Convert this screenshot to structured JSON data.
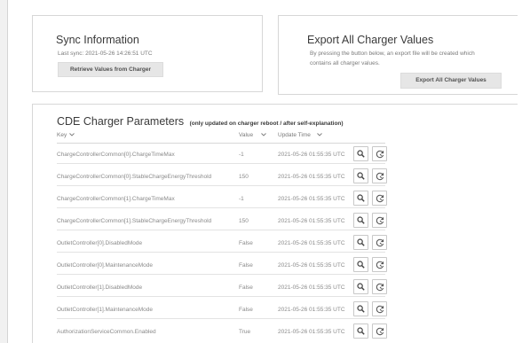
{
  "sync": {
    "title": "Sync Information",
    "last_sync": "Last sync: 2021-05-26 14:26:51 UTC",
    "button_label": "Retrieve Values from Charger"
  },
  "export": {
    "title": "Export All Charger Values",
    "description_line1": "By pressing the button below, an export file will be created which",
    "description_line2": "contains all charger values.",
    "button_label": "Export All Charger Values"
  },
  "params": {
    "title": "CDE Charger Parameters",
    "subtitle": "(only updated on charger reboot / after self-explanation)",
    "columns": {
      "key": "Key",
      "value": "Value",
      "time": "Update Time"
    },
    "rows": [
      {
        "key": "ChargeControllerCommon[0].ChargeTimeMax",
        "value": "-1",
        "time": "2021-05-26 01:55:35 UTC"
      },
      {
        "key": "ChargeControllerCommon[0].StableChargeEnergyThreshold",
        "value": "150",
        "time": "2021-05-26 01:55:35 UTC"
      },
      {
        "key": "ChargeControllerCommon[1].ChargeTimeMax",
        "value": "-1",
        "time": "2021-05-26 01:55:35 UTC"
      },
      {
        "key": "ChargeControllerCommon[1].StableChargeEnergyThreshold",
        "value": "150",
        "time": "2021-05-26 01:55:35 UTC"
      },
      {
        "key": "OutletController[0].DisabledMode",
        "value": "False",
        "time": "2021-05-26 01:55:35 UTC"
      },
      {
        "key": "OutletController[0].MaintenanceMode",
        "value": "False",
        "time": "2021-05-26 01:55:35 UTC"
      },
      {
        "key": "OutletController[1].DisabledMode",
        "value": "False",
        "time": "2021-05-26 01:55:35 UTC"
      },
      {
        "key": "OutletController[1].MaintenanceMode",
        "value": "False",
        "time": "2021-05-26 01:55:35 UTC"
      },
      {
        "key": "AuthorizationServiceCommon.Enabled",
        "value": "True",
        "time": "2021-05-26 01:55:35 UTC"
      }
    ]
  },
  "icons": {
    "row_action_1": "search-icon",
    "row_action_2": "reset-icon",
    "sort": "chevron-down-icon"
  }
}
